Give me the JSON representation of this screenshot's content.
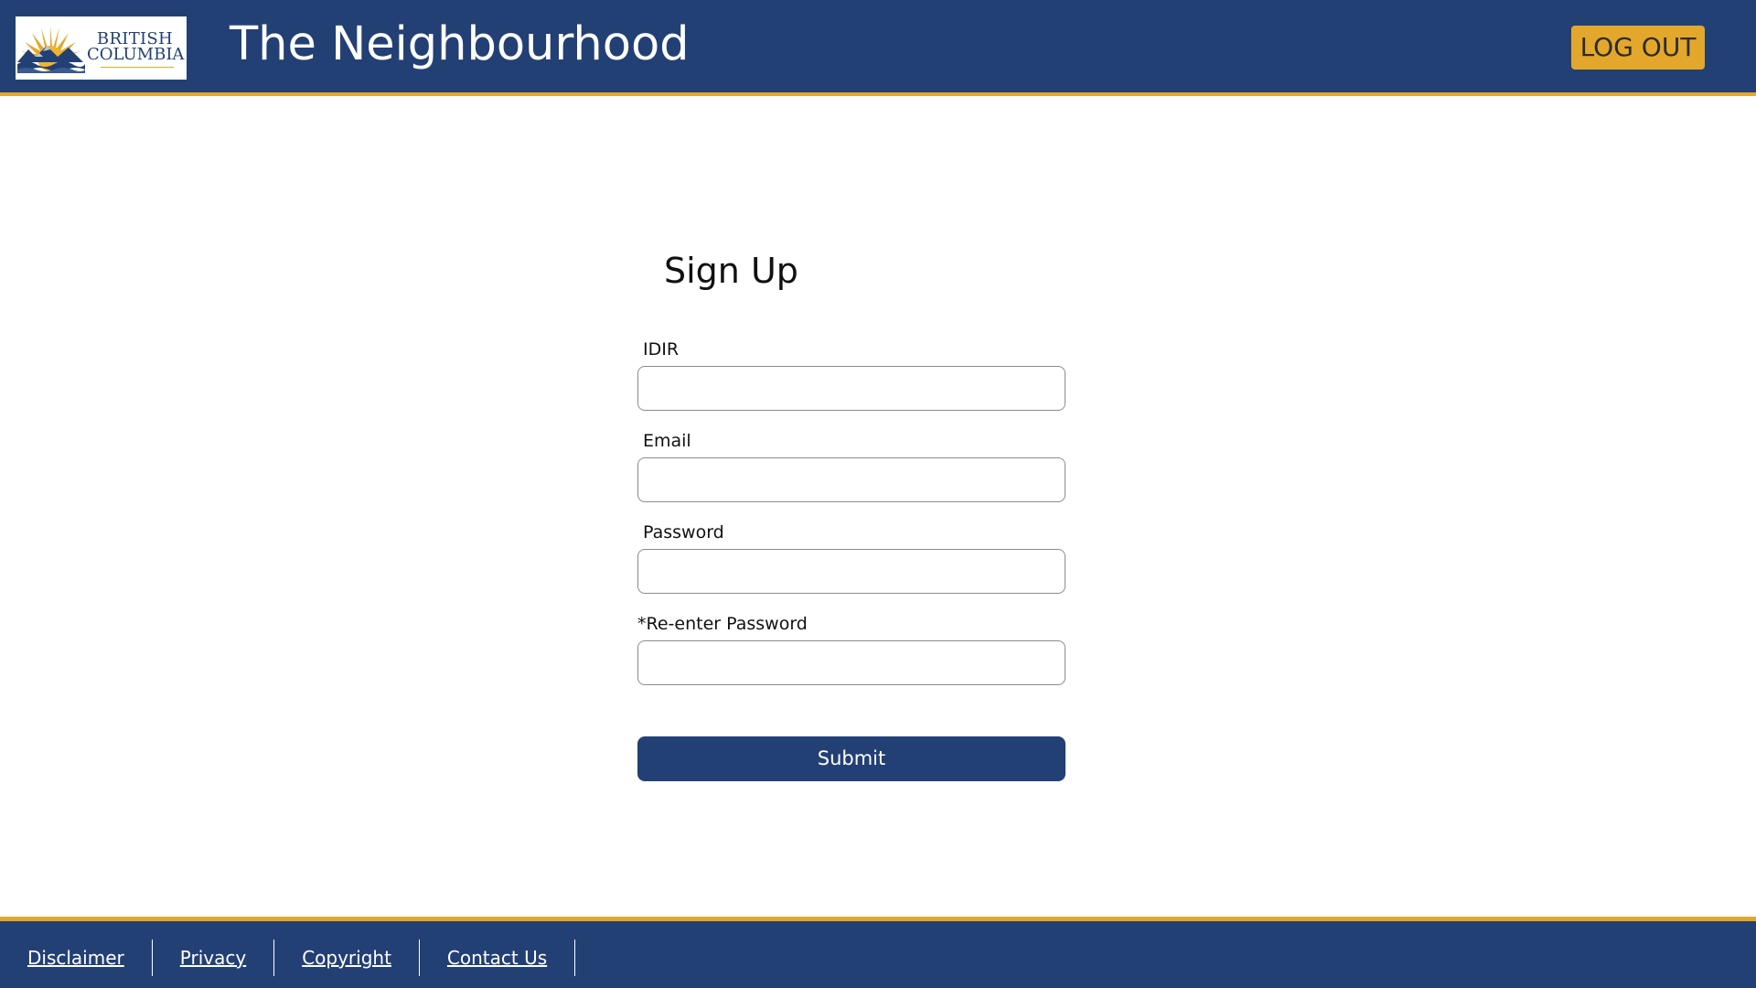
{
  "header": {
    "logo": {
      "line1": "BRITISH",
      "line2": "COLUMBIA"
    },
    "title": "The Neighbourhood",
    "logout_label": "LOG OUT"
  },
  "form": {
    "title": "Sign Up",
    "fields": [
      {
        "label": "IDIR",
        "value": ""
      },
      {
        "label": "Email",
        "value": ""
      },
      {
        "label": "Password",
        "value": ""
      },
      {
        "label": "*Re-enter Password",
        "value": ""
      }
    ],
    "submit_label": "Submit"
  },
  "footer": {
    "links": [
      {
        "label": "Disclaimer"
      },
      {
        "label": "Privacy"
      },
      {
        "label": "Copyright"
      },
      {
        "label": "Contact Us"
      }
    ]
  },
  "colors": {
    "brand_blue": "#234075",
    "brand_gold": "#e3a82b"
  }
}
